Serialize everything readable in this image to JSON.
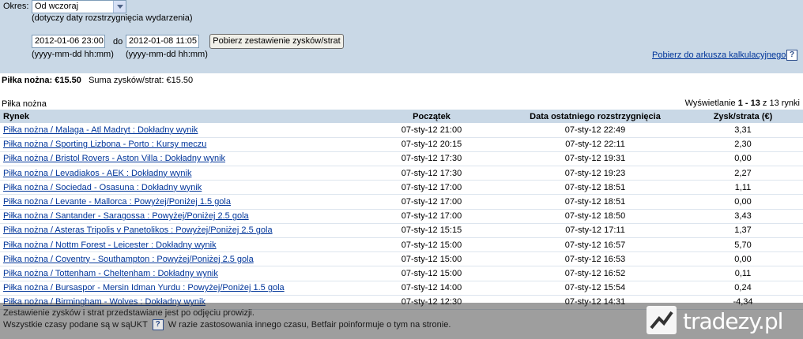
{
  "filter": {
    "period_label": "Okres:",
    "period_value": "Od wczoraj",
    "period_note": "(dotyczy daty rozstrzygnięcia wydarzenia)",
    "date_from": "2012-01-06 23:00",
    "date_to_label": "do",
    "date_to": "2012-01-08 11:05",
    "date_format_hint": "(yyyy-mm-dd hh:mm)",
    "submit_label": "Pobierz zestawienie zysków/strat",
    "export_label": "Pobierz do arkusza kalkulacyjnego",
    "help_glyph": "?"
  },
  "summary": {
    "sport_total": "Piłka nożna: €15.50",
    "total_label": "Suma zysków/strat:",
    "total_value": "€15.50"
  },
  "section": {
    "title": "Piłka nożna",
    "paging_prefix": "Wyświetlanie",
    "paging_range": "1 - 13",
    "paging_suffix": "z 13 rynki"
  },
  "table": {
    "headers": [
      "Rynek",
      "Początek",
      "Data ostatniego rozstrzygnięcia",
      "Zysk/strata (€)"
    ],
    "rows": [
      {
        "market": "Piłka nożna / Malaga - Atl Madryt : Dokładny wynik",
        "start": "07-sty-12 21:00",
        "settled": "07-sty-12 22:49",
        "pl": "3,31"
      },
      {
        "market": "Piłka nożna / Sporting Lizbona - Porto : Kursy meczu",
        "start": "07-sty-12 20:15",
        "settled": "07-sty-12 22:11",
        "pl": "2,30"
      },
      {
        "market": "Piłka nożna / Bristol Rovers - Aston Villa : Dokładny wynik",
        "start": "07-sty-12 17:30",
        "settled": "07-sty-12 19:31",
        "pl": "0,00"
      },
      {
        "market": "Piłka nożna / Levadiakos - AEK : Dokładny wynik",
        "start": "07-sty-12 17:30",
        "settled": "07-sty-12 19:23",
        "pl": "2,27"
      },
      {
        "market": "Piłka nożna / Sociedad - Osasuna : Dokładny wynik",
        "start": "07-sty-12 17:00",
        "settled": "07-sty-12 18:51",
        "pl": "1,11"
      },
      {
        "market": "Piłka nożna / Levante - Mallorca : Powyżej/Poniżej 1.5 gola",
        "start": "07-sty-12 17:00",
        "settled": "07-sty-12 18:51",
        "pl": "0,00"
      },
      {
        "market": "Piłka nożna / Santander - Saragossa : Powyżej/Poniżej 2.5 gola",
        "start": "07-sty-12 17:00",
        "settled": "07-sty-12 18:50",
        "pl": "3,43"
      },
      {
        "market": "Piłka nożna / Asteras Tripolis v Panetolikos : Powyżej/Poniżej 2.5 gola",
        "start": "07-sty-12 15:15",
        "settled": "07-sty-12 17:11",
        "pl": "1,37"
      },
      {
        "market": "Piłka nożna / Nottm Forest - Leicester : Dokładny wynik",
        "start": "07-sty-12 15:00",
        "settled": "07-sty-12 16:57",
        "pl": "5,70"
      },
      {
        "market": "Piłka nożna / Coventry - Southampton : Powyżej/Poniżej 2.5 gola",
        "start": "07-sty-12 15:00",
        "settled": "07-sty-12 16:53",
        "pl": "0,00"
      },
      {
        "market": "Piłka nożna / Tottenham - Cheltenham : Dokładny wynik",
        "start": "07-sty-12 15:00",
        "settled": "07-sty-12 16:52",
        "pl": "0,11"
      },
      {
        "market": "Piłka nożna / Bursaspor - Mersin Idman Yurdu : Powyżej/Poniżej 1.5 gola",
        "start": "07-sty-12 14:00",
        "settled": "07-sty-12 15:54",
        "pl": "0,24"
      },
      {
        "market": "Piłka nożna / Birmingham - Wolves : Dokładny wynik",
        "start": "07-sty-12 12:30",
        "settled": "07-sty-12 14:31",
        "pl": "-4,34"
      }
    ]
  },
  "footer": {
    "line1": "Zestawienie zysków i strat przedstawiane jest po odjęciu prowizji.",
    "line2_a": "Wszystkie czasy podane są w są",
    "line2_b": "UKT",
    "line2_c": "W razie zastosowania innego czasu, Betfair poinformuje o tym na stronie."
  },
  "watermark": {
    "text": "tradezy.pl"
  }
}
